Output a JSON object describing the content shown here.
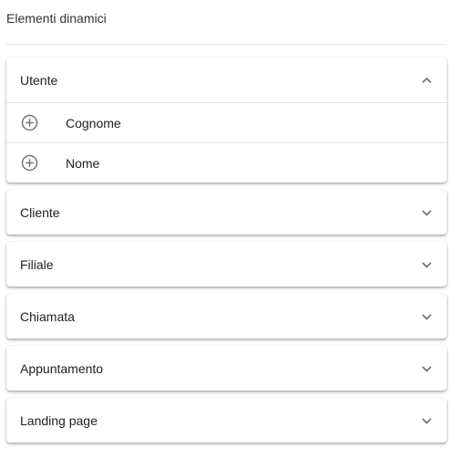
{
  "header": {
    "title": "Elementi dinamici"
  },
  "panels": [
    {
      "title": "Utente",
      "expanded": true,
      "items": [
        {
          "label": "Cognome",
          "icon": "add-circle-icon"
        },
        {
          "label": "Nome",
          "icon": "add-circle-icon"
        }
      ]
    },
    {
      "title": "Cliente",
      "expanded": false
    },
    {
      "title": "Filiale",
      "expanded": false
    },
    {
      "title": "Chiamata",
      "expanded": false
    },
    {
      "title": "Appuntamento",
      "expanded": false
    },
    {
      "title": "Landing page",
      "expanded": false
    }
  ],
  "icons": {
    "expanded": "chevron-up-icon",
    "collapsed": "chevron-down-icon",
    "add": "add-circle-icon"
  },
  "colors": {
    "icon": "#757575",
    "divider": "#e4e4e4"
  }
}
